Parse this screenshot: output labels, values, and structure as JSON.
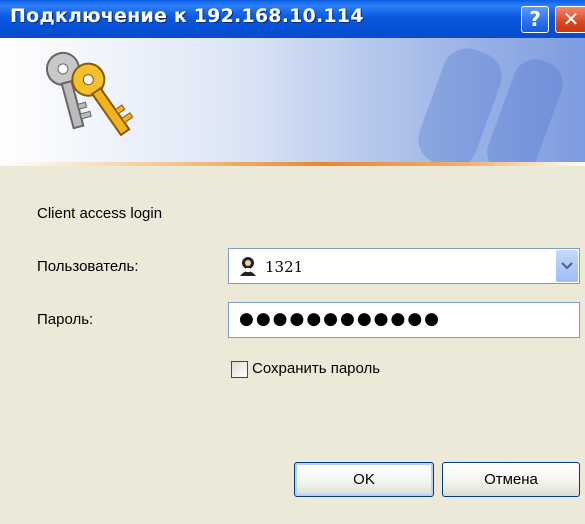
{
  "window": {
    "title": "Подключение к 192.168.10.114",
    "help_glyph": "?",
    "close_glyph": "✕"
  },
  "dialog": {
    "prompt": "Client access login",
    "username_label": "Пользователь:",
    "username_value": "1321",
    "password_label": "Пароль:",
    "password_value": "●●●●●●●●●●●●",
    "remember_label": "Сохранить пароль",
    "remember_checked": false,
    "ok_label": "OK",
    "cancel_label": "Отмена"
  },
  "icons": {
    "banner": "keys-icon",
    "user": "user-icon",
    "dropdown": "chevron-down-icon"
  }
}
